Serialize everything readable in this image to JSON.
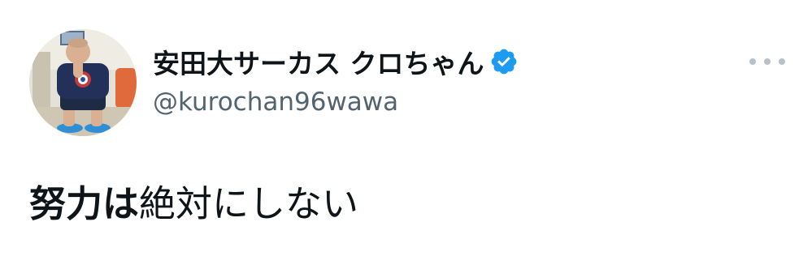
{
  "tweet": {
    "author": {
      "display_name": "安田大サーカス クロちゃん",
      "handle": "@kurochan96wawa",
      "verified": true,
      "avatar_icon": "profile-photo"
    },
    "text_bold": "努力は",
    "text_regular": "絶対にしない",
    "more_icon": "ellipsis-icon"
  },
  "colors": {
    "verified_badge": "#1d9bf0",
    "handle_text": "#536471",
    "primary_text": "#0f1419",
    "more_dots": "#b9c0c6"
  }
}
